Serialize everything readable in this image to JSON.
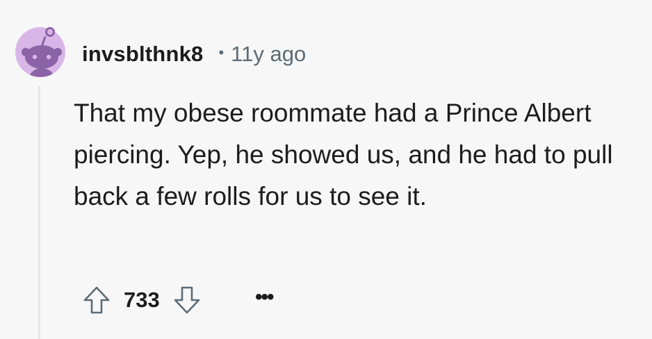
{
  "comment": {
    "username": "invsblthnk8",
    "separator": "•",
    "timestamp": "11y ago",
    "body": "That my obese roommate had a Prince Albert piercing. Yep, he showed us, and he had to pull back a few rolls for us to see it.",
    "score": "733",
    "more_label": "•••"
  },
  "icons": {
    "avatar": "reddit-snoo-avatar-icon",
    "upvote": "upvote-arrow-icon",
    "downvote": "downvote-arrow-icon",
    "more": "ellipsis-icon"
  },
  "colors": {
    "background": "#f7f7f7",
    "avatar_bg": "#d9b6e8",
    "avatar_figure": "#8b63a6",
    "meta_text": "#5c6b76",
    "thread_line": "#e3e5e8"
  }
}
